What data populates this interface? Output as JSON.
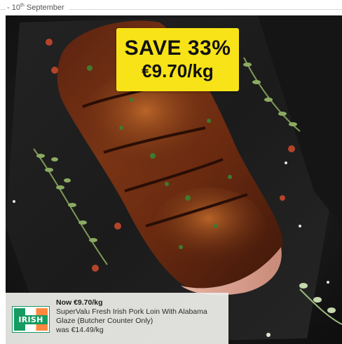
{
  "header": {
    "date_day": "10",
    "date_suffix": "th",
    "date_month": "September",
    "date_prefix": "- "
  },
  "badge": {
    "headline": "SAVE 33%",
    "price": "€9.70/kg",
    "color": "#f7e318"
  },
  "product": {
    "now_price": "Now €9.70/kg",
    "name": "SuperValu Fresh Irish Pork Loin With Alabama Glaze (Butcher Counter Only)",
    "was_price": "was €14.49/kg",
    "origin_logo_text": "IRISH"
  },
  "image": {
    "subject": "glazed pork loin on slate board with thyme sprigs",
    "icon": "product-photo"
  }
}
